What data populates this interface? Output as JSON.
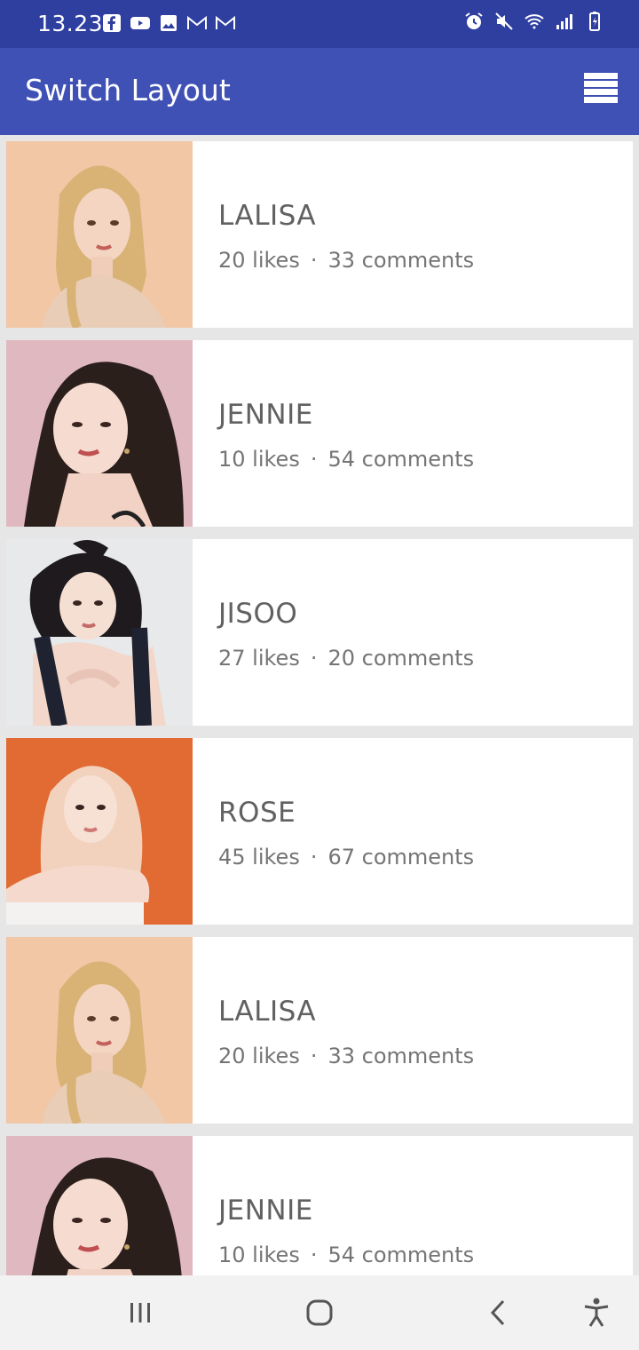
{
  "status_bar": {
    "time": "13.23",
    "left_icons": [
      "facebook-icon",
      "youtube-icon",
      "gallery-icon",
      "gmail-icon",
      "gmail-icon"
    ],
    "right_icons": [
      "alarm-icon",
      "mute-icon",
      "wifi-icon",
      "signal-icon",
      "battery-icon"
    ]
  },
  "app_bar": {
    "title": "Switch Layout",
    "toggle_icon": "list-view-icon"
  },
  "items": [
    {
      "name": "LALISA",
      "likes": "20 likes",
      "comments": "33 comments",
      "photo_bg": "#f1c7a6"
    },
    {
      "name": "JENNIE",
      "likes": "10 likes",
      "comments": "54 comments",
      "photo_bg": "#e0b8bf"
    },
    {
      "name": "JISOO",
      "likes": "27 likes",
      "comments": "20 comments",
      "photo_bg": "#e8e9eb"
    },
    {
      "name": "ROSE",
      "likes": "45 likes",
      "comments": "67 comments",
      "photo_bg": "#e26a33"
    },
    {
      "name": "LALISA",
      "likes": "20 likes",
      "comments": "33 comments",
      "photo_bg": "#f1c7a6"
    },
    {
      "name": "JENNIE",
      "likes": "10 likes",
      "comments": "54 comments",
      "photo_bg": "#e0b8bf"
    }
  ],
  "separator": "·",
  "nav_bar": {
    "buttons": [
      "recents-icon",
      "home-icon",
      "back-icon",
      "accessibility-icon"
    ]
  },
  "colors": {
    "status_bar": "#2f3fa0",
    "app_bar": "#3f51b5",
    "background": "#e6e6e6"
  }
}
